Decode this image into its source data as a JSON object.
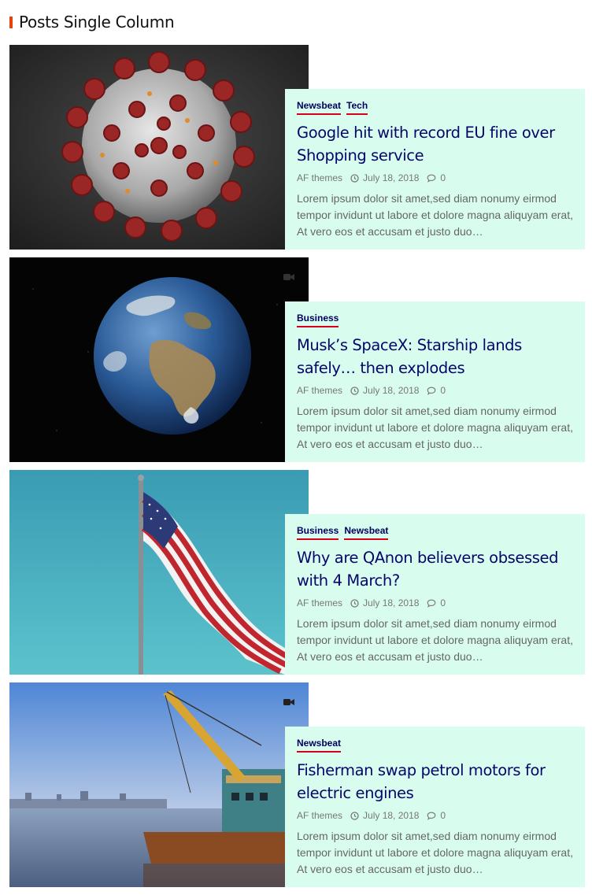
{
  "section": {
    "title": "Posts Single Column"
  },
  "colors": {
    "accent": "#e8420c",
    "card_bg": "#d8fdee",
    "title": "#05056a",
    "category_underline": "#d6001c"
  },
  "posts": [
    {
      "categories": [
        "Newsbeat",
        "Tech"
      ],
      "title": "Google hit with record EU fine over Shopping service",
      "author": "AF themes",
      "date": "July 18, 2018",
      "comments": "0",
      "excerpt": "Lorem ipsum dolor sit amet,sed diam nonumy eirmod tempor invidunt ut labore et dolore magna aliquyam erat, At vero eos et accusam et justo duo…",
      "image": "coronavirus-image",
      "video": false
    },
    {
      "categories": [
        "Business"
      ],
      "title": "Musk’s SpaceX: Starship lands safely… then explodes",
      "author": "AF themes",
      "date": "July 18, 2018",
      "comments": "0",
      "excerpt": "Lorem ipsum dolor sit amet,sed diam nonumy eirmod tempor invidunt ut labore et dolore magna aliquyam erat, At vero eos et accusam et justo duo…",
      "image": "earth-image",
      "video": true
    },
    {
      "categories": [
        "Business",
        "Newsbeat"
      ],
      "title": "Why are QAnon believers obsessed with 4 March?",
      "author": "AF themes",
      "date": "July 18, 2018",
      "comments": "0",
      "excerpt": "Lorem ipsum dolor sit amet,sed diam nonumy eirmod tempor invidunt ut labore et dolore magna aliquyam erat, At vero eos et accusam et justo duo…",
      "image": "us-flag-image",
      "video": false
    },
    {
      "categories": [
        "Newsbeat"
      ],
      "title": "Fisherman swap petrol motors for electric engines",
      "author": "AF themes",
      "date": "July 18, 2018",
      "comments": "0",
      "excerpt": "Lorem ipsum dolor sit amet,sed diam nonumy eirmod tempor invidunt ut labore et dolore magna aliquyam erat, At vero eos et accusam et justo duo…",
      "image": "crane-boat-image",
      "video": true
    }
  ]
}
